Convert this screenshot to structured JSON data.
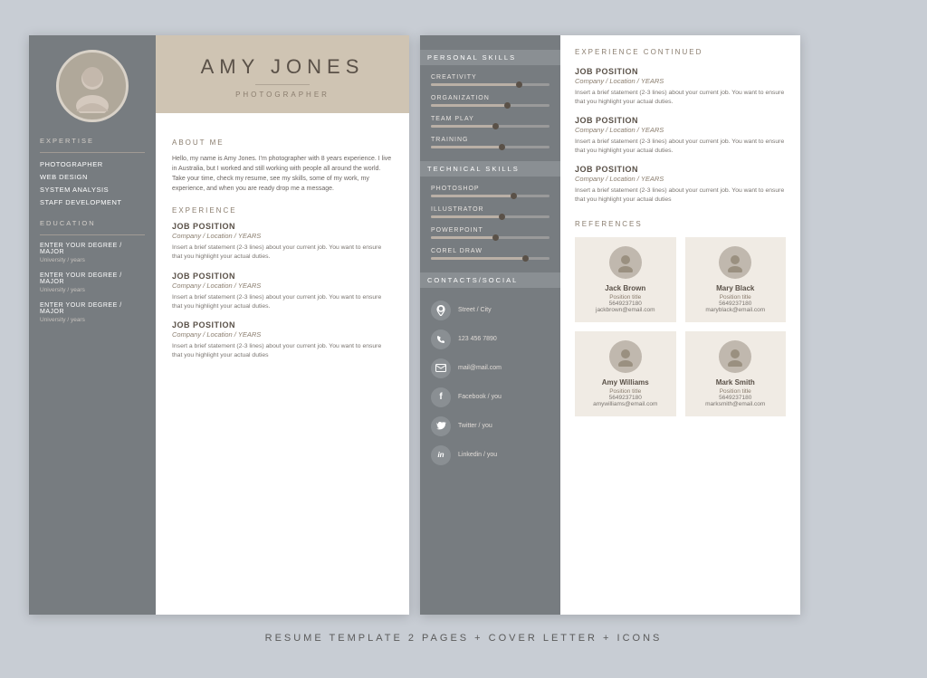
{
  "meta": {
    "bottom_text": "RESUME TEMPLATE 2 PAGES + COVER LETTER + ICONS"
  },
  "page1": {
    "left": {
      "expertise_title": "EXPERTISE",
      "expertise_items": [
        "PHOTOGRAPHER",
        "WEB DESIGN",
        "SYSTEM ANALYSIS",
        "STAFF DEVELOPMENT"
      ],
      "education_title": "EDUCATION",
      "education_items": [
        {
          "degree": "ENTER YOUR DEGREE / MAJOR",
          "institution": "University / years"
        },
        {
          "degree": "ENTER YOUR DEGREE / MAJOR",
          "institution": "University / years"
        },
        {
          "degree": "ENTER YOUR DEGREE / MAJOR",
          "institution": "University / years"
        }
      ]
    },
    "header": {
      "name": "AMY JONES",
      "title": "PHOTOGRAPHER"
    },
    "about": {
      "section_title": "ABOUT ME",
      "text": "Hello, my name is Amy Jones. I'm photographer with 8 years experience. I live in Australia, but I worked and still working with people all around the world. Take your time, check my resume, see my skills, some of my work, my experience, and when you are ready drop me a message."
    },
    "experience": {
      "section_title": "EXPERIENCE",
      "jobs": [
        {
          "title": "JOB POSITION",
          "company": "Company / Location / YEARS",
          "desc": "Insert a brief statement (2-3 lines) about your current job. You want to ensure that you highlight your actual duties."
        },
        {
          "title": "JOB POSITION",
          "company": "Company / Location / YEARS",
          "desc": "Insert a brief statement (2-3 lines) about your current job. You want to ensure that you highlight your actual duties."
        },
        {
          "title": "JOB POSITION",
          "company": "Company / Location / YEARS",
          "desc": "Insert a brief statement (2-3 lines) about your current job. You want to ensure that you highlight your actual duties"
        }
      ]
    }
  },
  "page2": {
    "left": {
      "personal_skills_title": "PERSONAL SKILLS",
      "personal_skills": [
        {
          "name": "CREATIVITY",
          "percent": 75
        },
        {
          "name": "ORGANIZATION",
          "percent": 65
        },
        {
          "name": "TEAM PLAY",
          "percent": 55
        },
        {
          "name": "TRAINING",
          "percent": 60
        }
      ],
      "technical_skills_title": "TECHNICAL SKILLS",
      "technical_skills": [
        {
          "name": "PHOTOSHOP",
          "percent": 70
        },
        {
          "name": "ILLUSTRATOR",
          "percent": 60
        },
        {
          "name": "POWERPOINT",
          "percent": 55
        },
        {
          "name": "COREL DRAW",
          "percent": 80
        }
      ],
      "contacts_title": "CONTACTS/SOCIAL",
      "contacts": [
        {
          "icon": "📍",
          "text": "Street / City"
        },
        {
          "icon": "📞",
          "text": "123 456 7890"
        },
        {
          "icon": "✉",
          "text": "mail@mail.com"
        },
        {
          "icon": "f",
          "text": "Facebook / you"
        },
        {
          "icon": "🐦",
          "text": "Twitter / you"
        },
        {
          "icon": "in",
          "text": "Linkedin / you"
        }
      ]
    },
    "right": {
      "exp_cont_title": "EXPERIENCE CONTINUED",
      "jobs": [
        {
          "title": "JOB POSITION",
          "company": "Company / Location / YEARS",
          "desc": "Insert a brief statement (2-3 lines) about your current job. You want to ensure that you highlight your actual duties."
        },
        {
          "title": "JOB POSITION",
          "company": "Company / Location / YEARS",
          "desc": "Insert a brief statement (2-3 lines) about your current job. You want to ensure that you highlight your actual duties."
        },
        {
          "title": "JOB POSITION",
          "company": "Company / Location / YEARS",
          "desc": "Insert a brief statement (2-3 lines) about your current job. You want to ensure that you highlight your actual duties"
        }
      ],
      "references_title": "REFERENCES",
      "references": [
        {
          "name": "Jack Brown",
          "position": "Position title",
          "phone": "5649237180",
          "email": "jackbrown@email.com"
        },
        {
          "name": "Mary Black",
          "position": "Position title",
          "phone": "5649237180",
          "email": "maryblack@email.com"
        },
        {
          "name": "Amy Williams",
          "position": "Position title",
          "phone": "5649237180",
          "email": "amywilliams@email.com"
        },
        {
          "name": "Mark Smith",
          "position": "Position title",
          "phone": "5649237180",
          "email": "marksmith@email.com"
        }
      ]
    }
  }
}
